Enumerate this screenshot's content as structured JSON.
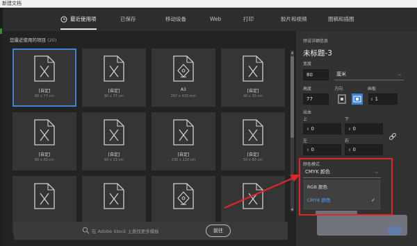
{
  "window": {
    "title": "新建文档"
  },
  "tabs": [
    {
      "label": "最近使用项",
      "active": true
    },
    {
      "label": "已保存"
    },
    {
      "label": "移动设备"
    },
    {
      "label": "Web"
    },
    {
      "label": "打印"
    },
    {
      "label": "胶片和视频"
    },
    {
      "label": "图稿和插图"
    }
  ],
  "recent": {
    "heading": "您最近使用的项目",
    "count": "(20)",
    "items": [
      {
        "name": "[自定]",
        "size": "80 x 77 cm",
        "icon": "file-icon",
        "selected": true
      },
      {
        "name": "[自定]",
        "size": "80 x 77 cm",
        "icon": "file-icon"
      },
      {
        "name": "A3",
        "size": "297 x 420 mm",
        "icon": "pen-file-icon"
      },
      {
        "name": "[自定]",
        "size": "40 x 30 cm",
        "icon": "file-icon"
      },
      {
        "name": "[自定]",
        "size": "80 x 60 cm",
        "icon": "file-icon"
      },
      {
        "name": "[自定]",
        "size": "60 x 13 cm",
        "icon": "file-icon"
      },
      {
        "name": "[自定]",
        "size": "230 x 110 cm",
        "icon": "file-icon"
      },
      {
        "name": "[自定]",
        "size": "50 x 80 cm",
        "icon": "file-icon"
      },
      {
        "name": "",
        "size": "",
        "icon": "file-icon"
      },
      {
        "name": "",
        "size": "",
        "icon": "file-icon"
      },
      {
        "name": "",
        "size": "",
        "icon": "pen-file-icon"
      },
      {
        "name": "",
        "size": "",
        "icon": "file-icon"
      }
    ]
  },
  "stock_search": {
    "placeholder": "在 Adobe Stock 上查找更多模板",
    "go_label": "前往"
  },
  "details": {
    "section_label": "预设详细信息",
    "title": "未标题-3",
    "width_label": "宽度",
    "width_value": "80",
    "unit": "厘米",
    "height_label": "高度",
    "height_value": "77",
    "orientation_label": "方向",
    "artboards_label": "画板",
    "artboards_value": "1",
    "bleed_label": "出血",
    "top_label": "上",
    "top_value": "0",
    "bottom_label": "下",
    "bottom_value": "0",
    "left_label": "左",
    "left_value": "0",
    "right_label": "右",
    "right_value": "0",
    "color_mode_label": "颜色模式",
    "color_mode_value": "CMYK 颜色",
    "color_options": [
      {
        "label": "RGB 颜色",
        "selected": false
      },
      {
        "label": "CMYK 颜色",
        "selected": true
      }
    ]
  },
  "colors": {
    "accent": "#3f84d8",
    "highlight": "#e0262a",
    "selected_text": "#5ba6ff"
  }
}
